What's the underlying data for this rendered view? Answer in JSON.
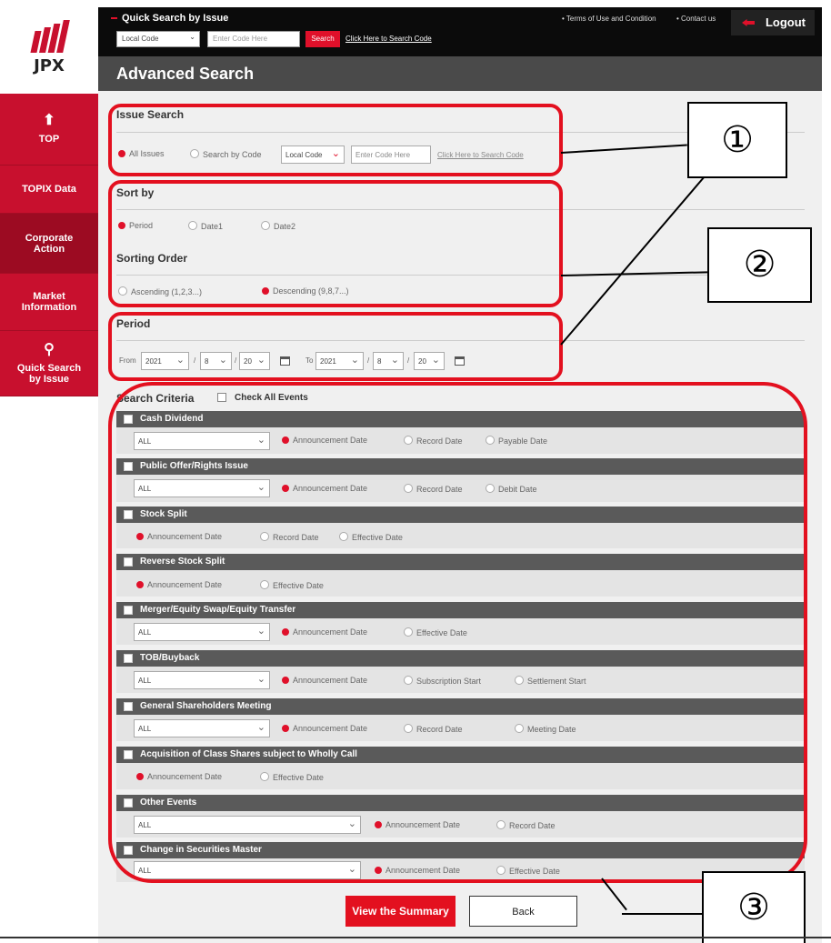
{
  "logo": {
    "text": "JPX"
  },
  "sidebar": {
    "items": [
      {
        "label": "TOP",
        "icon": "home-icon"
      },
      {
        "label": "TOPIX Data",
        "icon": ""
      },
      {
        "label": "Corporate Action",
        "icon": ""
      },
      {
        "label": "Market Information",
        "icon": ""
      },
      {
        "label": "Quick Search by Issue",
        "icon": "search-icon"
      }
    ]
  },
  "topbar": {
    "title": "Quick Search by Issue",
    "code_select": "Local Code",
    "code_placeholder": "Enter Code Here",
    "search_button": "Search",
    "search_link": "Click Here to Search Code",
    "terms": "• Terms of Use and Condition",
    "contact": "• Contact us",
    "logout": "Logout"
  },
  "header": {
    "title": "Advanced Search"
  },
  "issue_search": {
    "title": "Issue Search",
    "all_issues": "All Issues",
    "by_code": "Search by Code",
    "code_select": "Local Code",
    "code_placeholder": "Enter Code Here",
    "link": "Click Here to Search Code"
  },
  "sort_by": {
    "title": "Sort by",
    "options": [
      "Period",
      "Date1",
      "Date2"
    ]
  },
  "sorting_order": {
    "title": "Sorting Order",
    "asc": "Ascending (1,2,3...)",
    "desc": "Descending (9,8,7...)"
  },
  "period": {
    "title": "Period",
    "from_label": "From",
    "to_label": "To",
    "from": {
      "year": "2021",
      "month": "8",
      "day": "20"
    },
    "to": {
      "year": "2021",
      "month": "8",
      "day": "20"
    },
    "sep": "/"
  },
  "criteria": {
    "title": "Search Criteria",
    "check_all": "Check All Events"
  },
  "events": [
    {
      "name": "Cash Dividend",
      "select": "ALL",
      "dates": [
        "Announcement Date",
        "Record Date",
        "Payable Date"
      ]
    },
    {
      "name": "Public Offer/Rights Issue",
      "select": "ALL",
      "dates": [
        "Announcement Date",
        "Record Date",
        "Debit Date"
      ]
    },
    {
      "name": "Stock Split",
      "select": "",
      "dates": [
        "Announcement Date",
        "Record Date",
        "Effective Date"
      ]
    },
    {
      "name": "Reverse Stock Split",
      "select": "",
      "dates": [
        "Announcement Date",
        "Effective Date"
      ]
    },
    {
      "name": "Merger/Equity Swap/Equity Transfer",
      "select": "ALL",
      "dates": [
        "Announcement Date",
        "Effective Date"
      ]
    },
    {
      "name": "TOB/Buyback",
      "select": "ALL",
      "dates": [
        "Announcement Date",
        "Subscription Start",
        "Settlement Start"
      ]
    },
    {
      "name": "General Shareholders Meeting",
      "select": "ALL",
      "dates": [
        "Announcement Date",
        "Record Date",
        "Meeting Date"
      ]
    },
    {
      "name": "Acquisition of Class Shares subject to Wholly Call",
      "select": "",
      "dates": [
        "Announcement Date",
        "Effective Date"
      ]
    },
    {
      "name": "Other Events",
      "select": "ALL",
      "dates": [
        "Announcement Date",
        "Record Date"
      ]
    },
    {
      "name": "Change in Securities Master",
      "select": "ALL",
      "dates": [
        "Announcement Date",
        "Effective Date"
      ]
    }
  ],
  "buttons": {
    "view": "View the Summary",
    "back": "Back"
  },
  "annotations": [
    "①",
    "②",
    "③"
  ],
  "colors": {
    "brand_red": "#c8102e",
    "annotation_red": "#e3101f",
    "dark": "#0b0b0b"
  }
}
